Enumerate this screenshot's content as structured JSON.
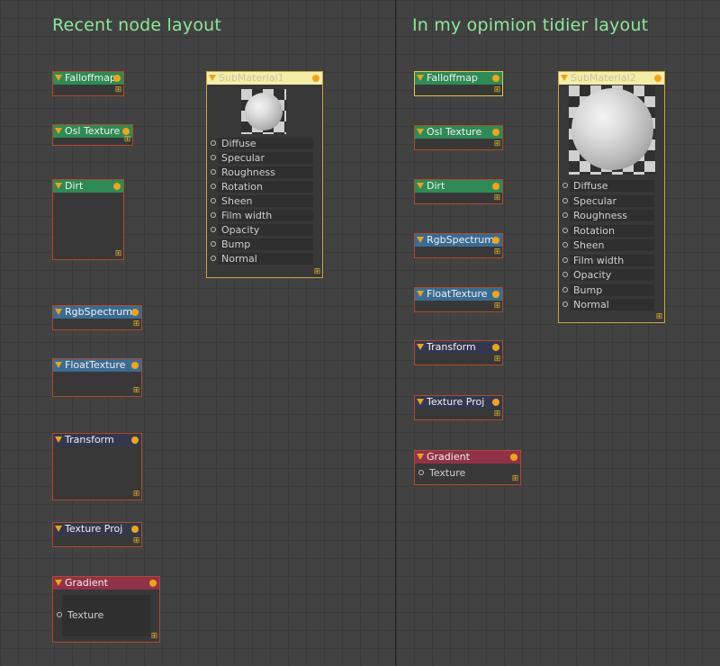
{
  "headings": {
    "left": "Recent node layout",
    "right": "In my opimion tidier layout"
  },
  "colors": {
    "heading": "#8ee89a",
    "texture_header": "#2f8a55",
    "value_header": "#3c6b92",
    "transform_header": "#33384e",
    "gradient_header": "#913248",
    "material_header": "#f4eda8",
    "output_pin": "#f0a41c"
  },
  "nodes": {
    "falloffmap": "Falloffmap",
    "osl_texture": "Osl Texture",
    "dirt": "Dirt",
    "rgb_spectrum": "RgbSpectrum",
    "float_texture": "FloatTexture",
    "transform": "Transform",
    "texture_proj": "Texture Proj",
    "gradient": "Gradient",
    "gradient_input": "Texture",
    "submaterial_left": "SubMaterial1",
    "submaterial_right": "SubMaterial2"
  },
  "material_inputs": [
    "Diffuse",
    "Specular",
    "Roughness",
    "Rotation",
    "Sheen",
    "Film width",
    "Opacity",
    "Bump",
    "Normal"
  ],
  "icons": {
    "collapse": "collapse-triangle-icon",
    "output": "output-pin-icon",
    "input": "input-pin-icon",
    "resize": "resize-grip-icon",
    "preview": "material-sphere-preview"
  }
}
